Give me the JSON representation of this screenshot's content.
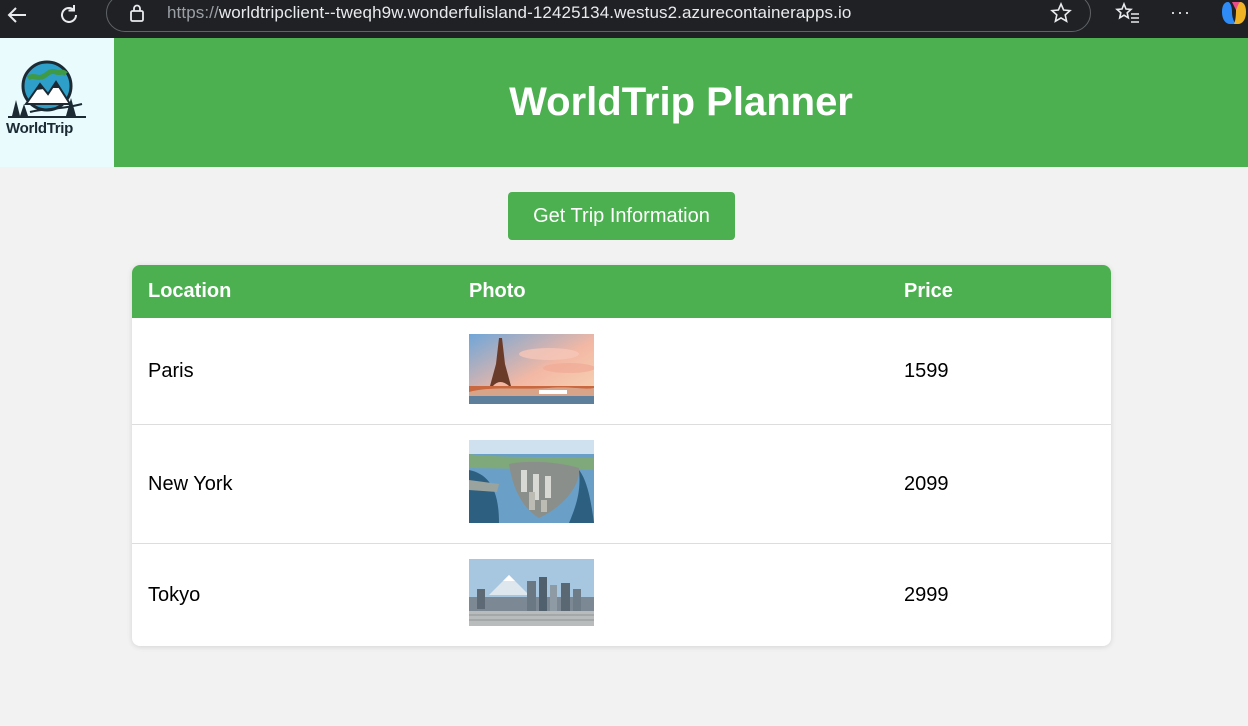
{
  "browser": {
    "url_scheme": "https://",
    "url_rest": "worldtripclient--tweqh9w.wonderfulisland-12425134.westus2.azurecontainerapps.io"
  },
  "header": {
    "logo_text": "WorldTrip",
    "title": "WorldTrip Planner",
    "color": "#4caf50"
  },
  "actions": {
    "get_trip_label": "Get Trip Information"
  },
  "table": {
    "columns": [
      "Location",
      "Photo",
      "Price"
    ],
    "rows": [
      {
        "location": "Paris",
        "photo": "eiffel-tower-photo",
        "price": "1599"
      },
      {
        "location": "New York",
        "photo": "manhattan-aerial-photo",
        "price": "2099"
      },
      {
        "location": "Tokyo",
        "photo": "tokyo-skyline-fuji-photo",
        "price": "2999"
      }
    ]
  }
}
